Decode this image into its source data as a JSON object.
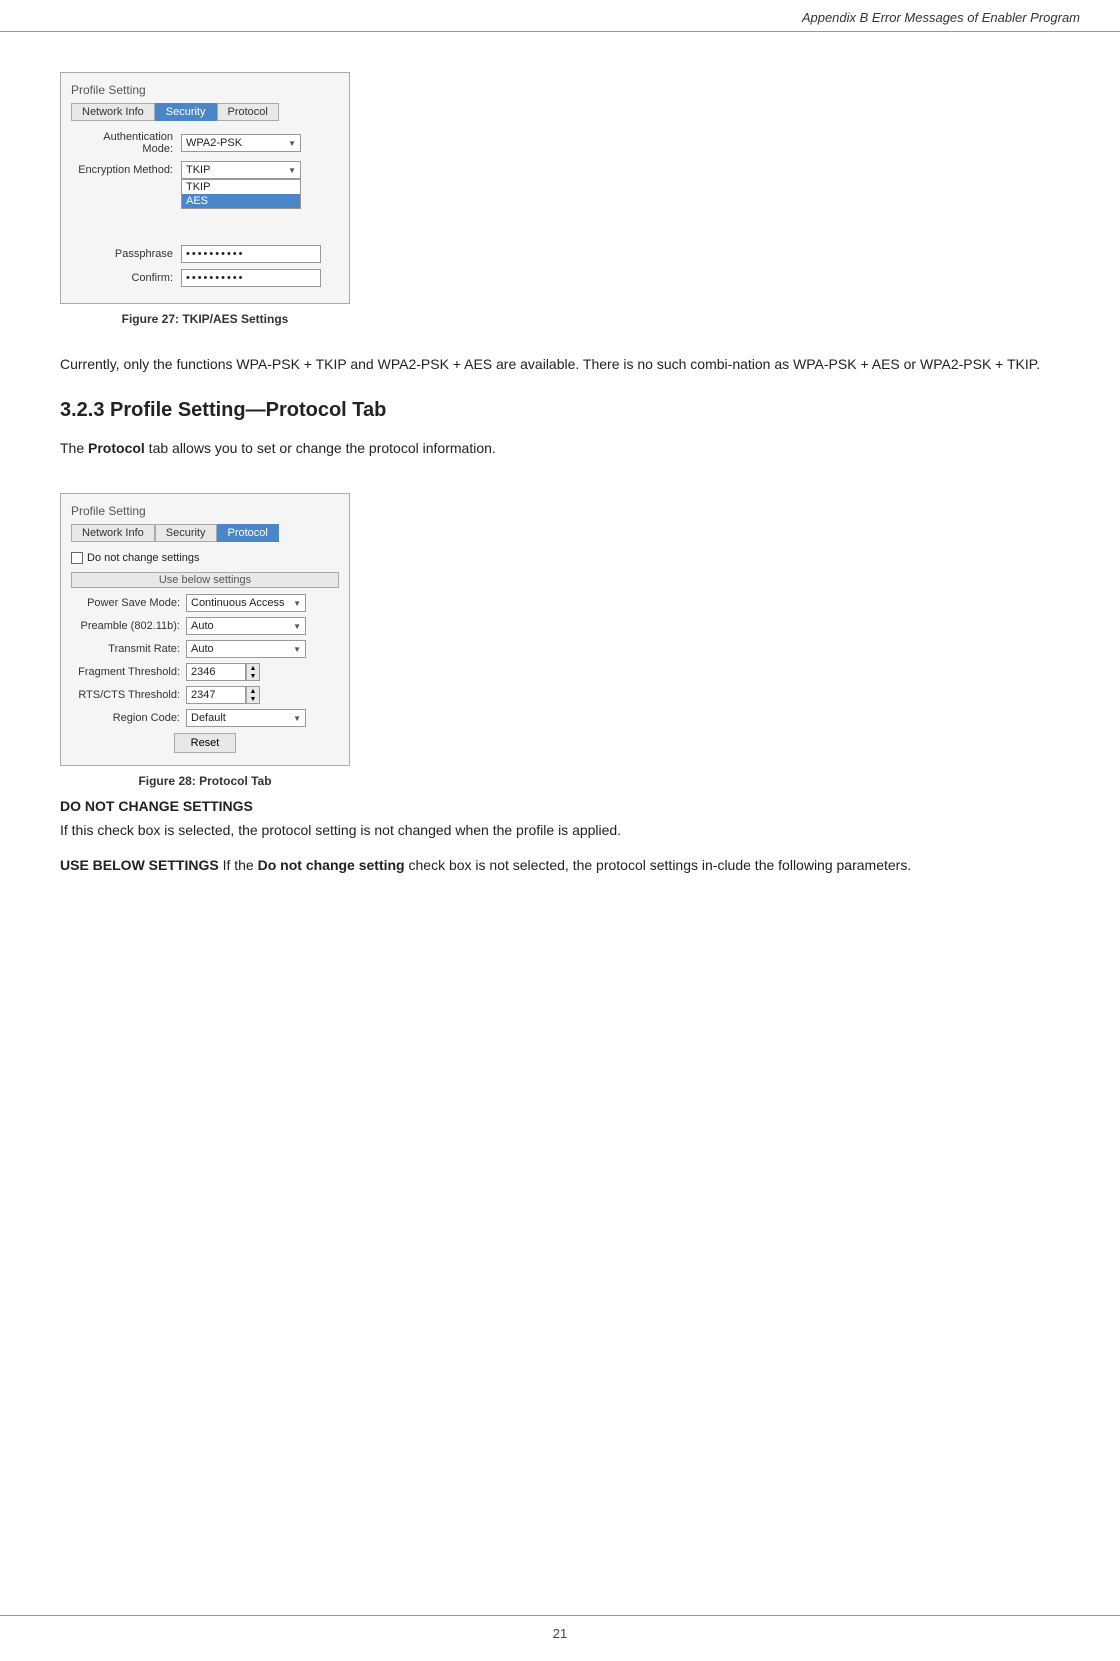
{
  "header": {
    "title": "Appendix B Error Messages of Enabler Program"
  },
  "figure27": {
    "title": "Profile Setting",
    "tabs": [
      "Network Info",
      "Security",
      "Protocol"
    ],
    "active_tab": "Security",
    "auth_mode_label": "Authentication Mode:",
    "auth_mode_value": "WPA2-PSK",
    "enc_method_label": "Encryption Method:",
    "enc_dropdown_visible": true,
    "enc_option1": "TKIP",
    "enc_option2": "AES",
    "enc_selected": "AES",
    "passphrase_label": "Passphrase",
    "passphrase_value": "••••••••••",
    "confirm_label": "Confirm:",
    "confirm_value": "••••••••••",
    "caption": "Figure 27: TKIP/AES Settings"
  },
  "paragraph1": "Currently, only the functions WPA-PSK + TKIP and WPA2-PSK + AES are available. There is no such combi-nation as WPA-PSK + AES or WPA2-PSK + TKIP.",
  "section323": {
    "heading": "3.2.3 Profile Setting—Protocol Tab",
    "intro": "The ",
    "intro_bold": "Protocol",
    "intro_rest": " tab allows you to set or change the protocol information."
  },
  "figure28": {
    "title": "Profile Setting",
    "tabs": [
      "Network Info",
      "Security",
      "Protocol"
    ],
    "active_tab": "Protocol",
    "do_not_change_label": "Do not change settings",
    "use_below_label": "Use below settings",
    "power_save_label": "Power Save Mode:",
    "power_save_value": "Continuous Access",
    "preamble_label": "Preamble (802.11b):",
    "preamble_value": "Auto",
    "transmit_label": "Transmit Rate:",
    "transmit_value": "Auto",
    "fragment_label": "Fragment Threshold:",
    "fragment_value": "2346",
    "rts_label": "RTS/CTS Threshold:",
    "rts_value": "2347",
    "region_label": "Region Code:",
    "region_value": "Default",
    "reset_label": "Reset",
    "caption": "Figure 28: Protocol Tab"
  },
  "do_not_change": {
    "heading": "DO NOT CHANGE SETTINGS",
    "text": "If this check box is selected, the protocol setting is not changed when the profile is applied."
  },
  "use_below": {
    "heading": "USE BELOW SETTINGS",
    "intro": "If the ",
    "bold_part": "Do not change setting",
    "rest": " check box is not selected, the protocol settings in-clude the following parameters."
  },
  "footer": {
    "page_number": "21"
  }
}
